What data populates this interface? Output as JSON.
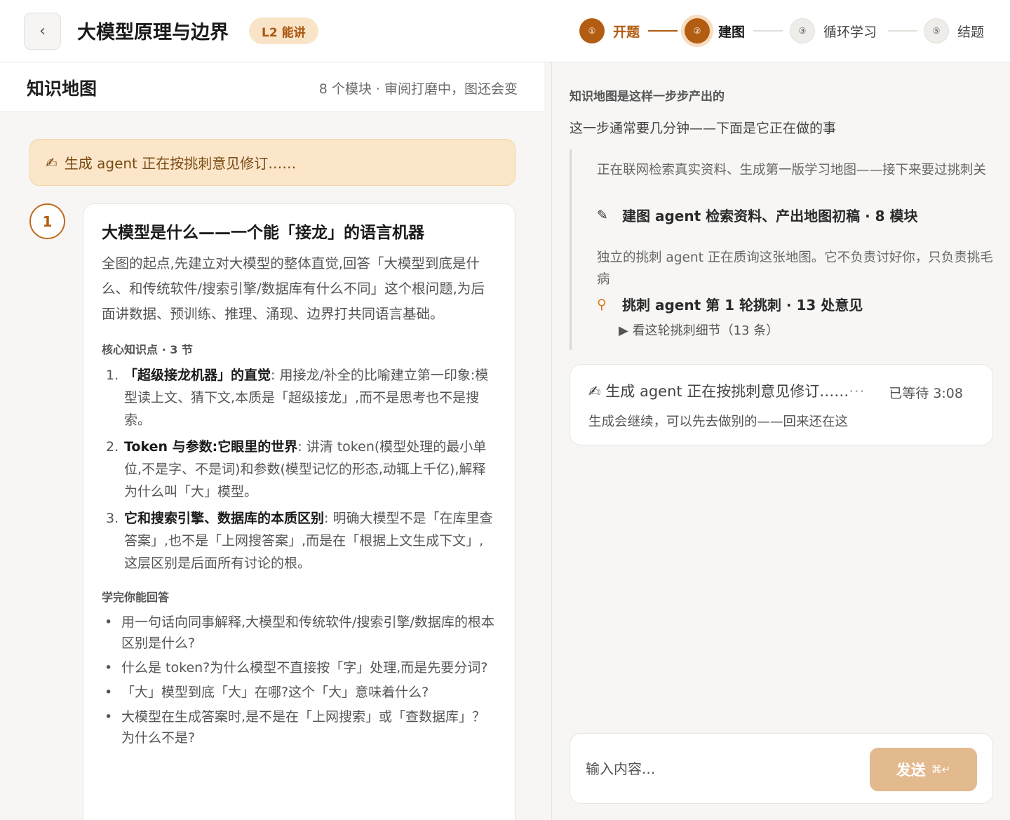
{
  "header": {
    "back_icon": "‹",
    "title": "大模型原理与边界",
    "badge": "L2 能讲",
    "steps": [
      {
        "num": "①",
        "label": "开题",
        "state": "done"
      },
      {
        "num": "②",
        "label": "建图",
        "state": "current"
      },
      {
        "num": "③",
        "label": "循环学习",
        "state": "todo"
      },
      {
        "num": "⑤",
        "label": "结题",
        "state": "todo"
      }
    ]
  },
  "left": {
    "title": "知识地图",
    "meta": "8 个模块 · 审阅打磨中，图还会变",
    "status_icon": "✍",
    "status_text": "生成 agent 正在按挑刺意见修订……",
    "module": {
      "num": "1",
      "title": "大模型是什么——一个能「接龙」的语言机器",
      "desc": "全图的起点,先建立对大模型的整体直觉,回答「大模型到底是什么、和传统软件/搜索引擎/数据库有什么不同」这个根问题,为后面讲数据、预训练、推理、涌现、边界打共同语言基础。",
      "kp_label": "核心知识点 · 3 节",
      "knowledge_points": [
        {
          "num": "1.",
          "head": "「超级接龙机器」的直觉",
          "body": ": 用接龙/补全的比喻建立第一印象:模型读上文、猜下文,本质是「超级接龙」,而不是思考也不是搜索。"
        },
        {
          "num": "2.",
          "head": "Token 与参数:它眼里的世界",
          "body": ": 讲清 token(模型处理的最小单位,不是字、不是词)和参数(模型记忆的形态,动辄上千亿),解释为什么叫「大」模型。"
        },
        {
          "num": "3.",
          "head": "它和搜索引擎、数据库的本质区别",
          "body": ": 明确大模型不是「在库里查答案」,也不是「上网搜答案」,而是在「根据上文生成下文」,这层区别是后面所有讨论的根。"
        }
      ],
      "q_label": "学完你能回答",
      "questions": [
        "用一句话向同事解释,大模型和传统软件/搜索引擎/数据库的根本区别是什么?",
        "什么是 token?为什么模型不直接按「字」处理,而是先要分词?",
        "「大」模型到底「大」在哪?这个「大」意味着什么?",
        "大模型在生成答案时,是不是在「上网搜索」或「查数据库」？为什么不是?"
      ]
    }
  },
  "right": {
    "head1": "知识地图是这样一步步产出的",
    "head2": "这一步通常要几分钟——下面是它正在做的事",
    "timeline": {
      "text1": "正在联网检索真实资料、生成第一版学习地图——接下来要过挑刺关",
      "action1_icon": "✎",
      "action1": "建图 agent 检索资料、产出地图初稿 · 8 模块",
      "text2": "独立的挑刺 agent 正在质询这张地图。它不负责讨好你，只负责挑毛病",
      "action2_icon": "⚲",
      "action2": "挑刺 agent 第 1 轮挑刺 · 13 处意见",
      "toggle": "▶ 看这轮挑刺细节（13 条）"
    },
    "wait": {
      "icon": "✍",
      "text": "生成 agent 正在按挑刺意见修订……",
      "dots": "···",
      "time": "已等待 3:08",
      "note": "生成会继续，可以先去做别的——回来还在这"
    },
    "input": {
      "placeholder": "输入内容...",
      "send_label": "发送",
      "send_kbd": "⌘↵"
    }
  }
}
